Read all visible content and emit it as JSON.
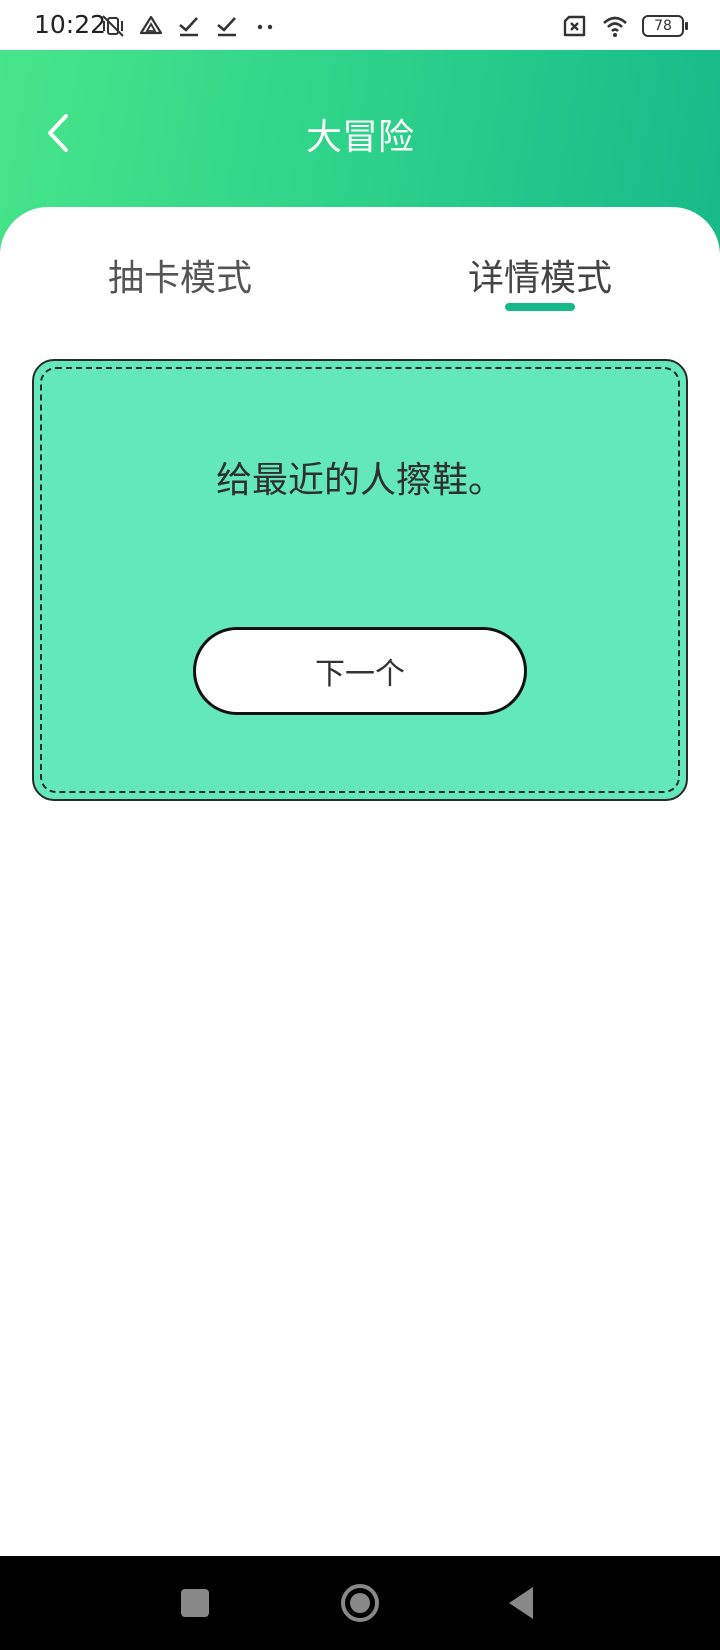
{
  "status_bar": {
    "time": "10:22",
    "battery": "78",
    "left_icons": [
      "vibrate-off-icon",
      "drive-icon",
      "check-download-icon",
      "check-download-icon",
      "more-dots-icon"
    ],
    "right_icons": [
      "sim-off-icon",
      "wifi-icon",
      "battery-icon"
    ]
  },
  "header": {
    "title": "大冒险",
    "back_icon": "chevron-left-icon",
    "gradient": [
      "#47e58a",
      "#17b98a"
    ]
  },
  "tabs": [
    {
      "label": "抽卡模式",
      "selected": false
    },
    {
      "label": "详情模式",
      "selected": true
    }
  ],
  "card": {
    "text": "给最近的人擦鞋。",
    "background": "#63e8bc",
    "button_label": "下一个"
  },
  "nav_bar": {
    "icons": [
      "recent-apps-icon",
      "home-icon",
      "back-icon"
    ]
  },
  "colors": {
    "accent": "#17b98a",
    "card": "#63e8bc"
  }
}
